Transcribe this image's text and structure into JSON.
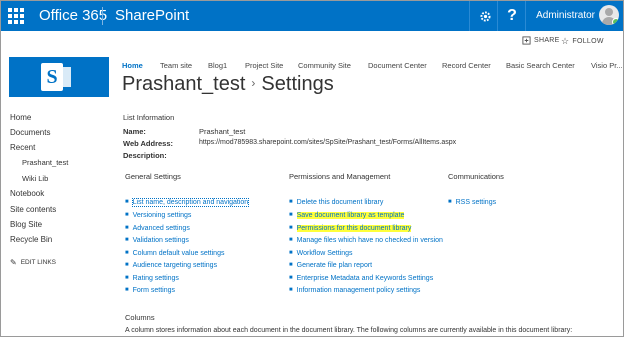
{
  "suite_bar": {
    "brand": "Office 365",
    "app": "SharePoint",
    "user_name": "Administrator",
    "icons": [
      "waffle-icon",
      "gear-icon",
      "help-icon",
      "avatar"
    ]
  },
  "actions": {
    "share": "SHARE",
    "follow": "FOLLOW"
  },
  "top_nav": [
    "Home",
    "Team site",
    "Blog1",
    "Project Site",
    "Community Site",
    "Document Center",
    "Record Center",
    "Basic Search Center",
    "Visio Pr..."
  ],
  "page_title": {
    "library": "Prashant_test",
    "page": "Settings"
  },
  "left_nav": {
    "items": [
      "Home",
      "Documents",
      "Recent",
      "Prashant_test",
      "Wiki Lib",
      "Notebook",
      "Site contents",
      "Blog Site",
      "Recycle Bin"
    ],
    "edit_links": "EDIT LINKS"
  },
  "list_info": {
    "heading": "List Information",
    "name_label": "Name:",
    "name_value": "Prashant_test",
    "web_label": "Web Address:",
    "web_value": "https://mod785983.sharepoint.com/sites/SpSite/Prashant_test/Forms/AllItems.aspx",
    "desc_label": "Description:"
  },
  "general_settings": {
    "heading": "General Settings",
    "links": [
      "List name, description and navigation",
      "Versioning settings",
      "Advanced settings",
      "Validation settings",
      "Column default value settings",
      "Audience targeting settings",
      "Rating settings",
      "Form settings"
    ]
  },
  "permissions": {
    "heading": "Permissions and Management",
    "links": [
      "Delete this document library",
      "Save document library as template",
      "Permissions for this document library",
      "Manage files which have no checked in version",
      "Workflow Settings",
      "Generate file plan report",
      "Enterprise Metadata and Keywords Settings",
      "Information management policy settings"
    ]
  },
  "communications": {
    "heading": "Communications",
    "links": [
      "RSS settings"
    ]
  },
  "columns": {
    "heading": "Columns",
    "description": "A column stores information about each document in the document library. The following columns are currently available in this document library:"
  },
  "colors": {
    "suite_bar": "#0072c6",
    "link": "#0072c6",
    "highlight": "#ffff3a"
  }
}
